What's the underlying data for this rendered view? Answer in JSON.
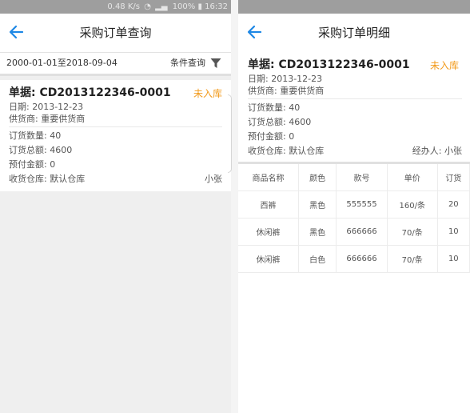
{
  "status_bar": {
    "left_text": "0.48 K/s",
    "battery": "100%",
    "time": "16:32"
  },
  "list_screen": {
    "title": "采购订单查询",
    "date_range": "2000-01-01至2018-09-04",
    "condition_query_label": "条件查询",
    "order": {
      "number": "单据: CD2013122346-0001",
      "status": "未入库",
      "date": "日期: 2013-12-23",
      "supplier": "供货商: 重要供货商",
      "quantity": "订货数量: 40",
      "total": "订货总额: 4600",
      "prepaid": "预付金额: 0",
      "warehouse": "收货仓库: 默认仓库",
      "handler": "小张"
    }
  },
  "detail_screen": {
    "title": "采购订单明细",
    "order": {
      "number": "单据: CD2013122346-0001",
      "status": "未入库",
      "date": "日期: 2013-12-23",
      "supplier": "供货商: 重要供货商",
      "quantity": "订货数量: 40",
      "total": "订货总额: 4600",
      "prepaid": "预付金额: 0",
      "warehouse": "收货仓库: 默认仓库",
      "handler": "经办人: 小张"
    },
    "table": {
      "headers": [
        "商品名称",
        "颜色",
        "款号",
        "单价",
        "订货"
      ],
      "rows": [
        [
          "西裤",
          "黑色",
          "555555",
          "160/条",
          "20"
        ],
        [
          "休闲裤",
          "黑色",
          "666666",
          "70/条",
          "10"
        ],
        [
          "休闲裤",
          "白色",
          "666666",
          "70/条",
          "10"
        ]
      ]
    }
  },
  "colors": {
    "accent_blue": "#1e88e5",
    "status_orange": "#f29b1d",
    "status_bar_gray": "#9e9e9e"
  },
  "icons": {
    "back": "arrow-left-icon",
    "filter": "funnel-filter-icon"
  }
}
